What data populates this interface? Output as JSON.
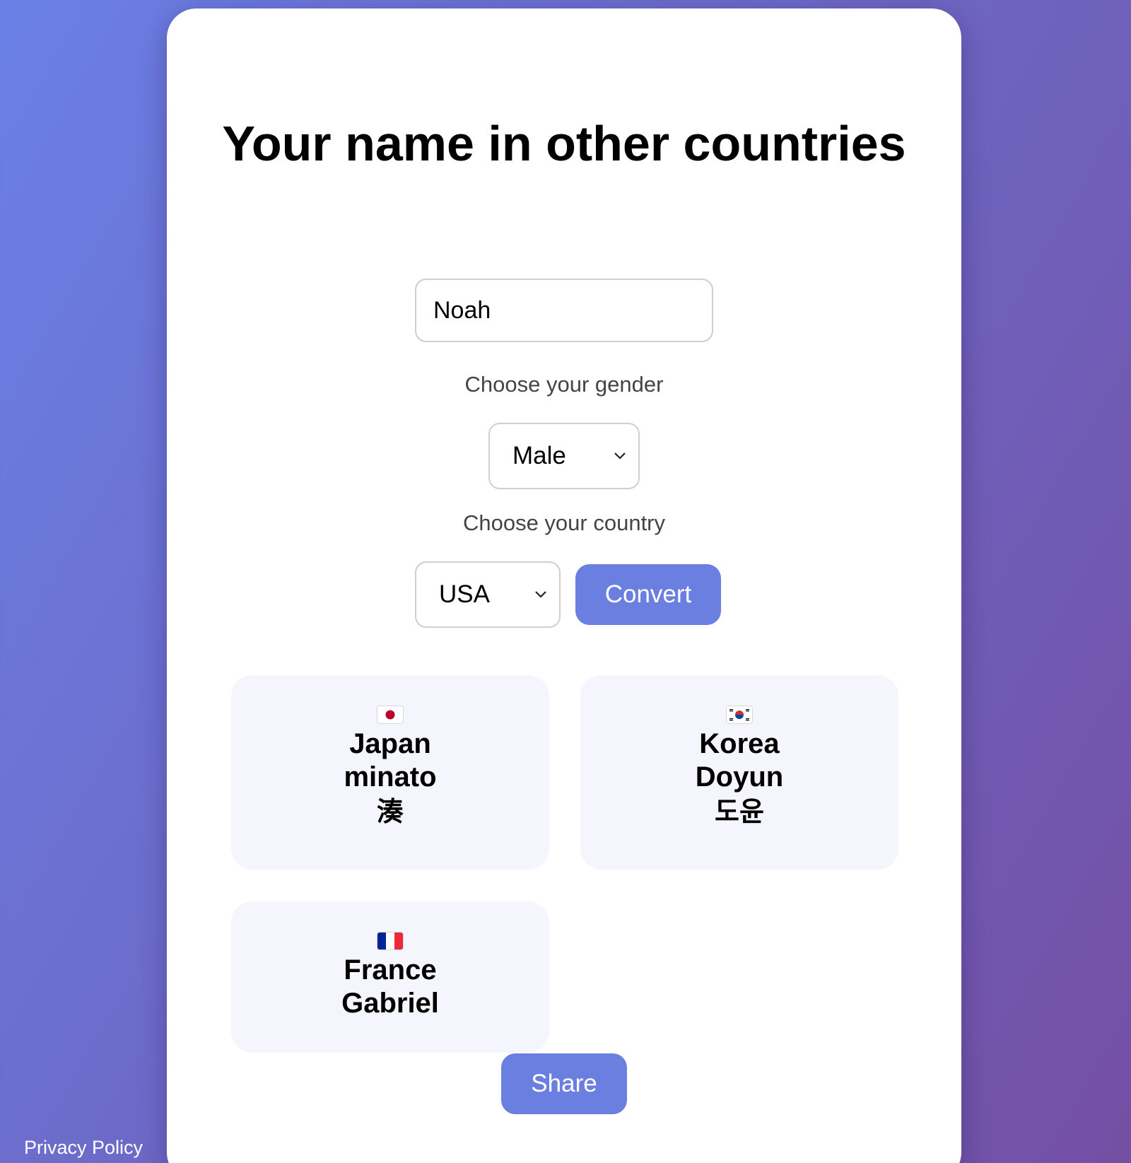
{
  "page": {
    "title": "Your name in other countries"
  },
  "form": {
    "name_value": "Noah",
    "gender_label": "Choose your gender",
    "gender_selected": "Male",
    "country_label": "Choose your country",
    "country_selected": "USA",
    "convert_label": "Convert"
  },
  "results": [
    {
      "country": "Japan",
      "name": "minato",
      "native": "湊",
      "flag_icon": "japan-flag-icon"
    },
    {
      "country": "Korea",
      "name": "Doyun",
      "native": "도윤",
      "flag_icon": "korea-flag-icon"
    },
    {
      "country": "France",
      "name": "Gabriel",
      "native": "",
      "flag_icon": "france-flag-icon"
    }
  ],
  "share_label": "Share",
  "footer": {
    "privacy_label": "Privacy Policy"
  },
  "colors": {
    "accent": "#6b7fe0",
    "result_bg": "#f4f5fd",
    "background_start": "#6a80e6",
    "background_end": "#744fa4"
  }
}
